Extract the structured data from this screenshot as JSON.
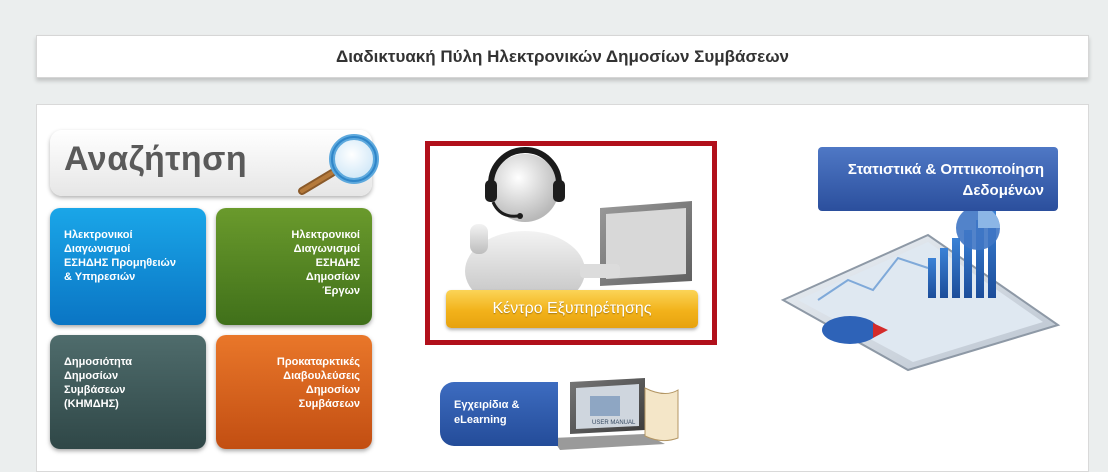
{
  "header": {
    "title": "Διαδικτυακή Πύλη Ηλεκτρονικών Δημοσίων Συμβάσεων"
  },
  "search": {
    "label": "Αναζήτηση",
    "icon": "magnifier-icon"
  },
  "tiles": [
    {
      "label": "Ηλεκτρονικοί Διαγωνισμοί ΕΣΗΔΗΣ Προμηθειών & Υπηρεσιών",
      "color": "#0a8ad6"
    },
    {
      "label": "Ηλεκτρονικοί Διαγωνισμοί ΕΣΗΔΗΣ Δημοσίων Έργων",
      "color": "#55852a"
    },
    {
      "label": "Δημοσιότητα Δημοσίων Συμβάσεων (ΚΗΜΔΗΣ)",
      "color": "#3f5959"
    },
    {
      "label": "Προκαταρκτικές Διαβουλεύσεις Δημοσίων Συμβάσεων",
      "color": "#d9631c"
    }
  ],
  "helpdesk": {
    "label": "Κέντρο Εξυπηρέτησης",
    "accent": "#f2b21a",
    "border": "#b1101b"
  },
  "stats": {
    "label": "Στατιστικά & Οπτικοποίηση Δεδομένων",
    "color": "#3a62b0"
  },
  "manuals": {
    "label": "Εγχειρίδια & eLearning",
    "book_text": "USER MANUAL"
  }
}
